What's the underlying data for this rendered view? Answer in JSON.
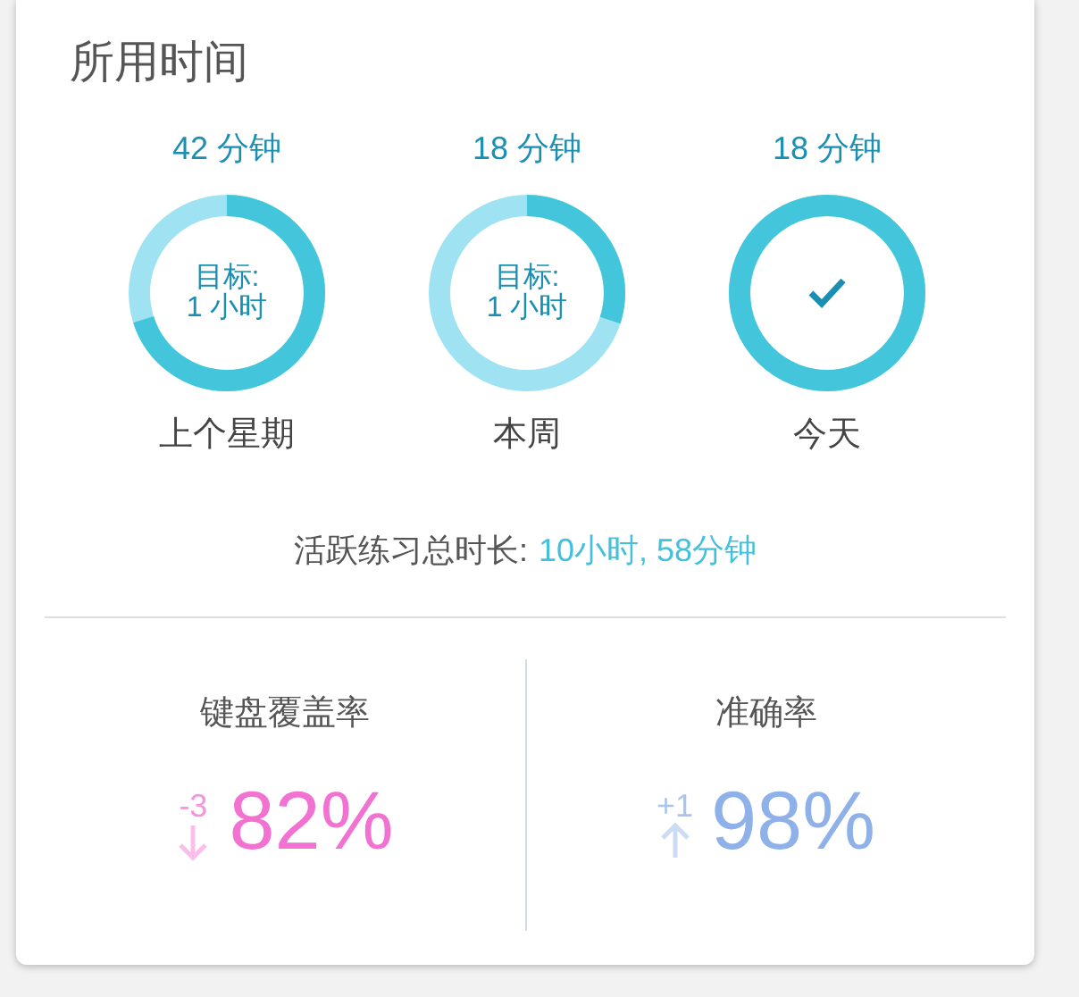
{
  "title": "所用时间",
  "periods": [
    {
      "minutes": "42 分钟",
      "level": 0.7,
      "achieved": false,
      "goal_label": "目标:",
      "goal_value": "1 小时",
      "label": "上个星期"
    },
    {
      "minutes": "18 分钟",
      "level": 0.3,
      "achieved": false,
      "goal_label": "目标:",
      "goal_value": "1 小时",
      "label": "本周"
    },
    {
      "minutes": "18 分钟",
      "level": 1,
      "achieved": true,
      "label": "今天"
    }
  ],
  "total": {
    "label": "活跃练习总时长:",
    "value": "10小时, 58分钟"
  },
  "stats": [
    {
      "label": "键盘覆盖率",
      "kind": "down",
      "change": "-3",
      "value": "82%",
      "color": "#f272d2"
    },
    {
      "label": "准确率",
      "kind": "up",
      "change": "+1",
      "value": "98%",
      "color": "#8db1e8"
    }
  ]
}
